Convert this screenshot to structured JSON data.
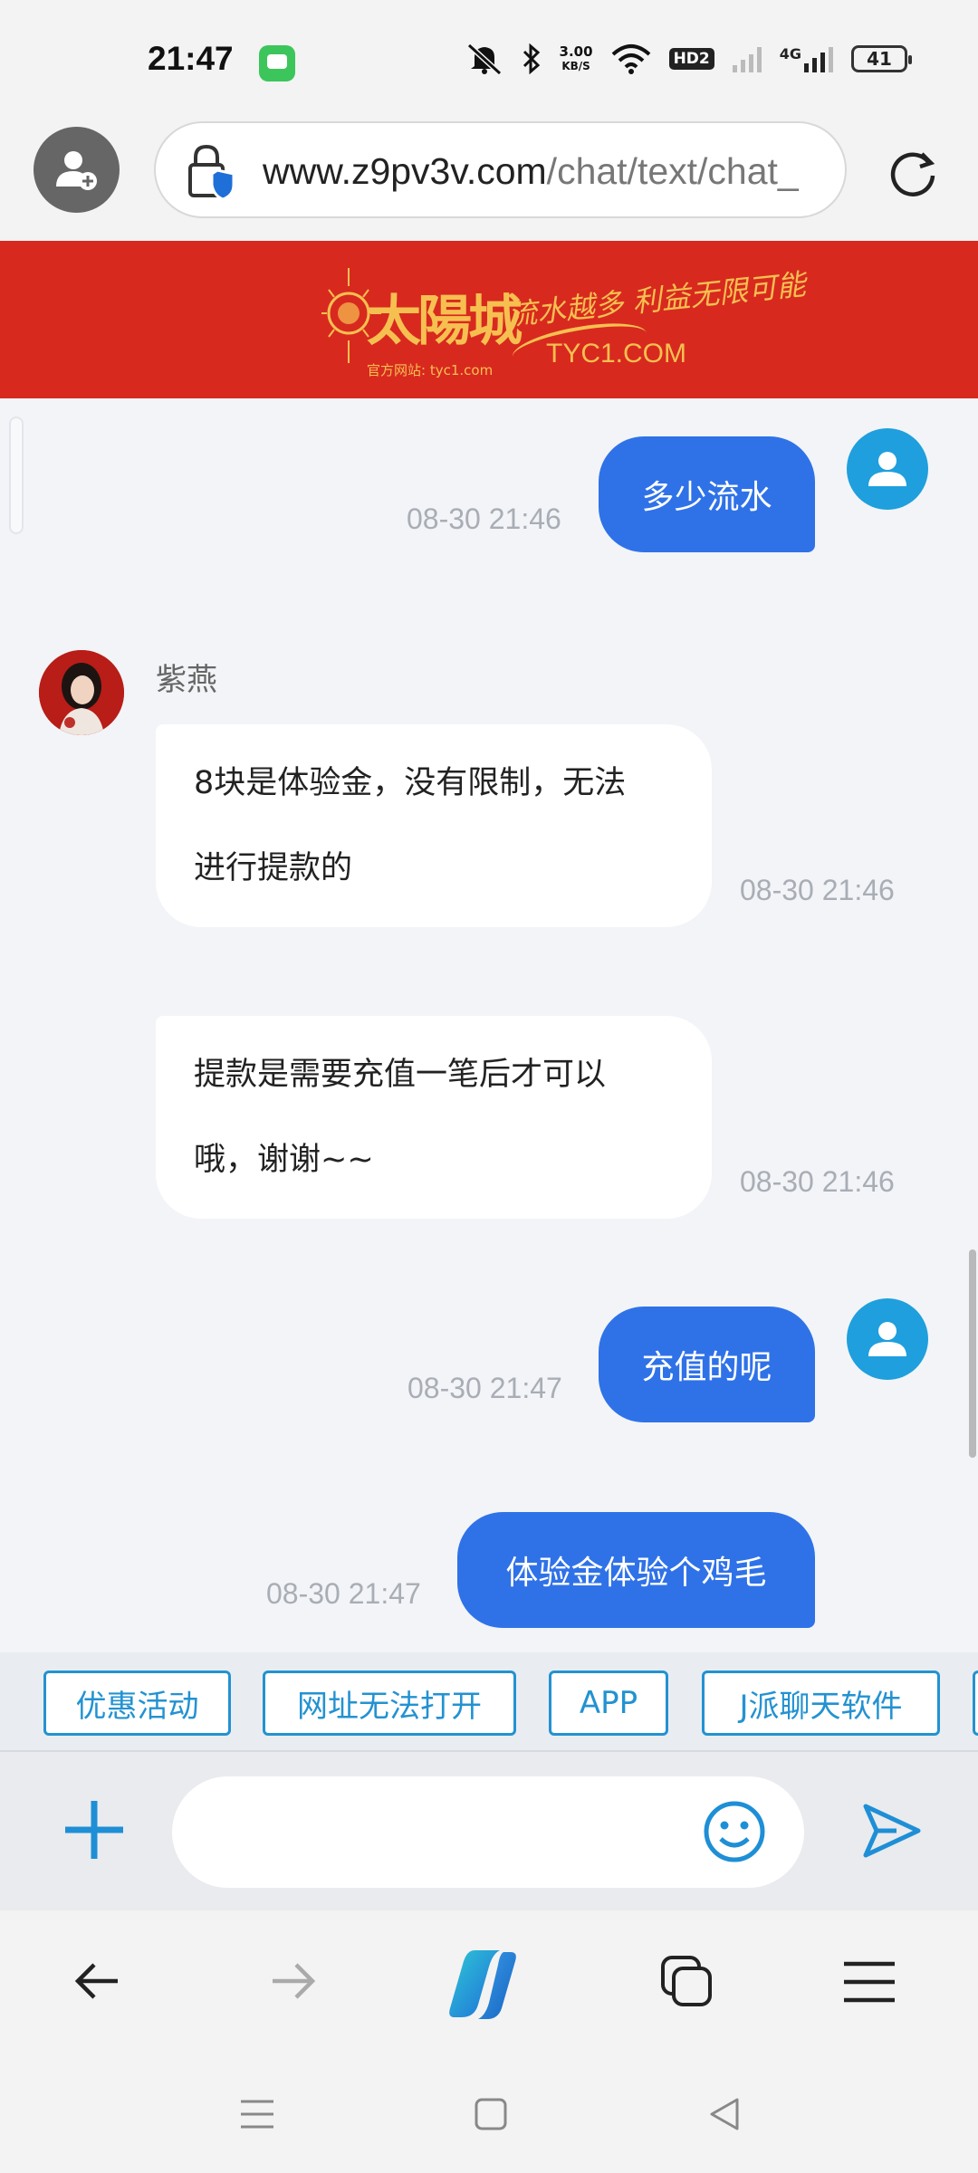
{
  "status_bar": {
    "time": "21:47",
    "net_speed_value": "3.00",
    "net_speed_unit": "KB/S",
    "hd_badge": "HD2",
    "network": "4G",
    "battery": "41",
    "icons": [
      "chat-app-icon",
      "mute-icon",
      "bluetooth-icon",
      "wifi-icon",
      "signal-icon",
      "battery-icon"
    ]
  },
  "browser": {
    "url_domain": "www.z9pv3v.com",
    "url_path": "/chat/text/chat_",
    "icons": [
      "profile-add-icon",
      "lock-shield-icon",
      "reload-icon"
    ]
  },
  "banner": {
    "brand": "太陽城",
    "site_note": "官方网站: tyc1.com",
    "slogan": "流水越多 利益无限可能",
    "domain": "TYC1.COM"
  },
  "chat": {
    "agent_name": "紫燕",
    "messages": [
      {
        "side": "out",
        "text": "多少流水",
        "time": "08-30 21:46"
      },
      {
        "side": "in",
        "line1": "8块是体验金，没有限制，无法",
        "line2": "进行提款的",
        "time": "08-30 21:46"
      },
      {
        "side": "in",
        "line1": "提款是需要充值一笔后才可以",
        "line2": "哦，谢谢~~",
        "time": "08-30 21:46"
      },
      {
        "side": "out",
        "text": "充值的呢",
        "time": "08-30 21:47"
      },
      {
        "side": "out",
        "text": "体验金体验个鸡毛",
        "time": "08-30 21:47"
      }
    ]
  },
  "quick_replies": [
    "优惠活动",
    "网址无法打开",
    "APP",
    "J派聊天软件"
  ],
  "input": {
    "placeholder": "",
    "icons": [
      "plus-icon",
      "emoji-icon",
      "send-icon"
    ]
  },
  "nav": {
    "icons": [
      "back-arrow-icon",
      "forward-arrow-icon",
      "copilot-icon",
      "tabs-icon",
      "menu-icon"
    ]
  },
  "system_nav": {
    "icons": [
      "recents-icon",
      "home-icon",
      "back-triangle-icon"
    ]
  },
  "colors": {
    "accent_blue": "#2f72e8",
    "chip_blue": "#2392d1",
    "banner_red": "#d8291f",
    "user_avatar": "#1f9fdd"
  }
}
